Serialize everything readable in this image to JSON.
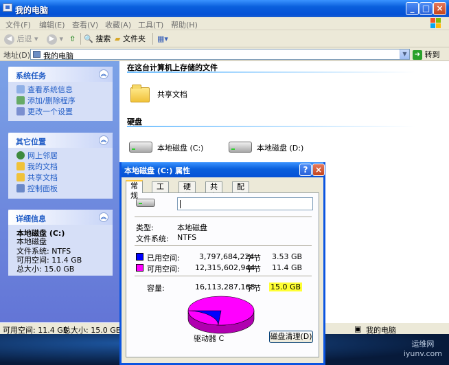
{
  "window": {
    "title": "我的电脑",
    "menu": [
      "文件(F)",
      "编辑(E)",
      "查看(V)",
      "收藏(A)",
      "工具(T)",
      "帮助(H)"
    ],
    "toolbar": {
      "back": "后退",
      "search": "搜索",
      "folders": "文件夹"
    },
    "address_label": "地址(D)",
    "address_value": "我的电脑",
    "go_label": "转到"
  },
  "sidebar": {
    "system_tasks": {
      "title": "系统任务",
      "items": [
        "查看系统信息",
        "添加/删除程序",
        "更改一个设置"
      ]
    },
    "other_places": {
      "title": "其它位置",
      "items": [
        "网上邻居",
        "我的文档",
        "共享文档",
        "控制面板"
      ]
    },
    "details": {
      "title": "详细信息",
      "name": "本地磁盘 (C:)",
      "type": "本地磁盘",
      "fs": "文件系统: NTFS",
      "free": "可用空间: 11.4 GB",
      "total": "总大小: 15.0 GB"
    }
  },
  "content": {
    "group_files": "在这台计算机上存储的文件",
    "shared_docs": "共享文档",
    "group_disks": "硬盘",
    "drive_c": "本地磁盘 (C:)",
    "drive_d": "本地磁盘 (D:)"
  },
  "statusbar": {
    "free": "可用空间: 11.4 GB",
    "total": "总大小: 15.0 GB",
    "location": "我的电脑"
  },
  "dialog": {
    "title": "本地磁盘 (C:) 属性",
    "tabs": [
      "常规",
      "工具",
      "硬件",
      "共享",
      "配额"
    ],
    "type_label": "类型:",
    "type_value": "本地磁盘",
    "fs_label": "文件系统:",
    "fs_value": "NTFS",
    "used": {
      "label": "已用空间:",
      "bytes": "3,797,684,224",
      "unit": "字节",
      "size": "3.53 GB",
      "color": "#0000ff"
    },
    "free": {
      "label": "可用空间:",
      "bytes": "12,315,602,944",
      "unit": "字节",
      "size": "11.4 GB",
      "color": "#ff00ff"
    },
    "capacity": {
      "label": "容量:",
      "bytes": "16,113,287,168",
      "unit": "字节",
      "size": "15.0 GB"
    },
    "used_fraction": 0.236,
    "drive_label": "驱动器 C",
    "cleanup_button": "磁盘清理(D)"
  },
  "watermark": {
    "line1": "运维网",
    "line2": "iyunv.com"
  }
}
